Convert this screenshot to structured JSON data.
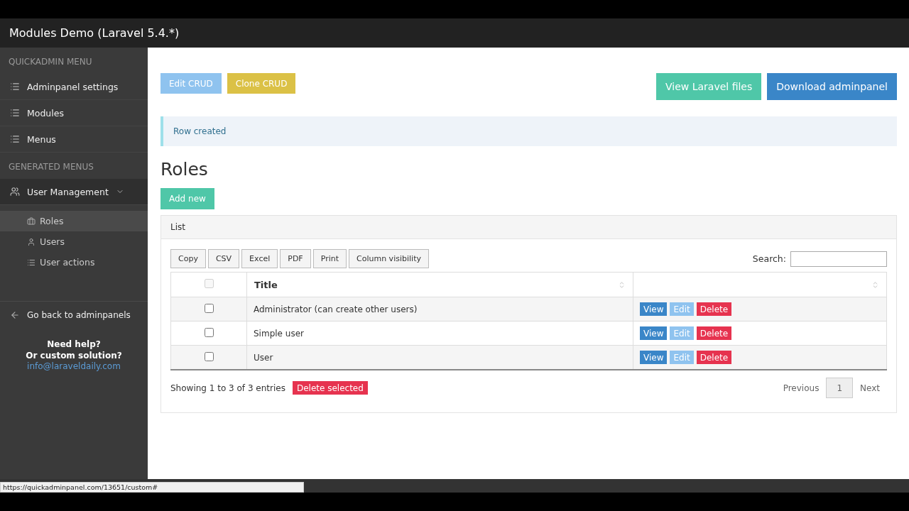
{
  "header": {
    "title": "Modules Demo (Laravel 5.4.*)"
  },
  "sidebar": {
    "sections": [
      {
        "heading": "QUICKADMIN MENU",
        "items": [
          {
            "label": "Adminpanel settings"
          },
          {
            "label": "Modules"
          },
          {
            "label": "Menus"
          }
        ]
      },
      {
        "heading": "GENERATED MENUS",
        "items": [
          {
            "label": "User Management",
            "expanded": true,
            "children": [
              {
                "label": "Roles",
                "selected": true
              },
              {
                "label": "Users",
                "selected": false
              },
              {
                "label": "User actions",
                "selected": false
              }
            ]
          }
        ]
      }
    ],
    "back_link": "Go back to adminpanels",
    "help_lines": [
      "Need help?",
      "Or custom solution?"
    ],
    "help_email": "info@laraveldaily.com"
  },
  "toolbar": {
    "left": [
      {
        "label": "Edit CRUD",
        "kind": "info"
      },
      {
        "label": "Clone CRUD",
        "kind": "warning"
      }
    ],
    "right": [
      {
        "label": "View Laravel files",
        "kind": "success"
      },
      {
        "label": "Download adminpanel",
        "kind": "primary"
      }
    ]
  },
  "alert": "Row created",
  "page_title": "Roles",
  "add_button": "Add new",
  "panel": {
    "heading": "List",
    "export_buttons": [
      "Copy",
      "CSV",
      "Excel",
      "PDF",
      "Print",
      "Column visibility"
    ],
    "search_label": "Search:",
    "select_all": {
      "checked": false,
      "disabled": true
    },
    "columns": [
      "Title"
    ],
    "rows": [
      {
        "checked": false,
        "title": "Administrator (can create other users)",
        "actions": [
          {
            "label": "View",
            "kind": "primary"
          },
          {
            "label": "Edit",
            "kind": "info"
          },
          {
            "label": "Delete",
            "kind": "danger"
          }
        ]
      },
      {
        "checked": false,
        "title": "Simple user",
        "actions": [
          {
            "label": "View",
            "kind": "primary"
          },
          {
            "label": "Edit",
            "kind": "info"
          },
          {
            "label": "Delete",
            "kind": "danger"
          }
        ]
      },
      {
        "checked": false,
        "title": "User",
        "actions": [
          {
            "label": "View",
            "kind": "primary"
          },
          {
            "label": "Edit",
            "kind": "info"
          },
          {
            "label": "Delete",
            "kind": "danger"
          }
        ]
      }
    ],
    "info": "Showing 1 to 3 of 3 entries",
    "delete_selected": "Delete selected",
    "pagination": [
      {
        "label": "Previous",
        "kind": "nav",
        "selected": false
      },
      {
        "label": "1",
        "kind": "page",
        "selected": true
      },
      {
        "label": "Next",
        "kind": "nav",
        "selected": false
      }
    ]
  },
  "status_url": "https://quickadminpanel.com/13651/custom#"
}
